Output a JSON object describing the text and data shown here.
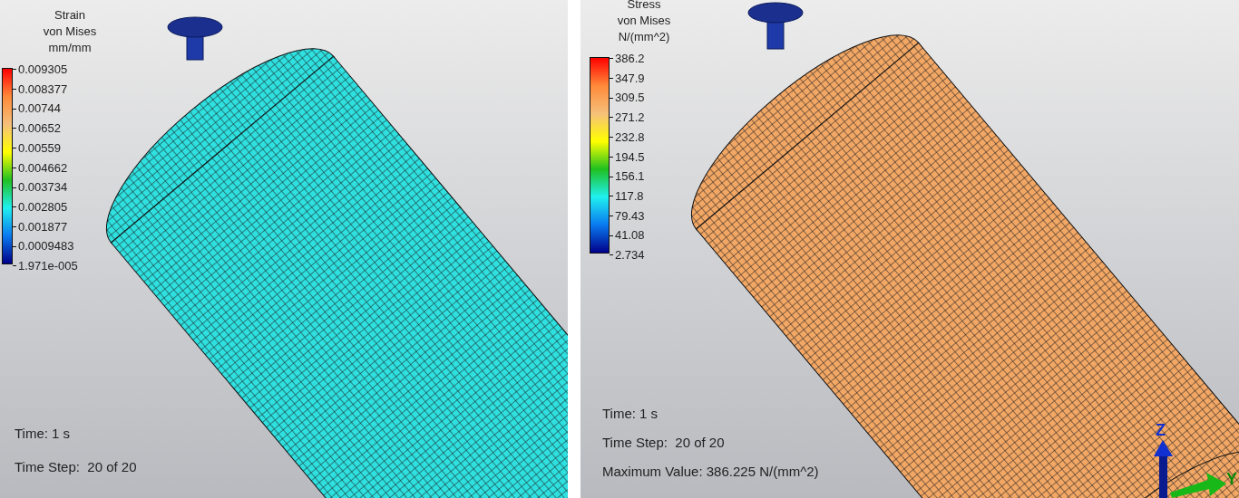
{
  "panels": [
    {
      "color": "#2fe0e0",
      "legend": {
        "title": [
          "Strain",
          "von Mises",
          "mm/mm"
        ],
        "labels": [
          "0.009305",
          "0.008377",
          "0.00744",
          "0.00652",
          "0.00559",
          "0.004662",
          "0.003734",
          "0.002805",
          "0.001877",
          "0.0009483",
          "1.971e-005"
        ]
      },
      "info": [
        "Time: 1 s",
        "Time Step:  20 of 20"
      ]
    },
    {
      "color": "#f2a765",
      "legend": {
        "title": [
          "Stress",
          "von Mises",
          "N/(mm^2)"
        ],
        "labels": [
          "386.2",
          "347.9",
          "309.5",
          "271.2",
          "232.8",
          "194.5",
          "156.1",
          "117.8",
          "79.43",
          "41.08",
          "2.734"
        ]
      },
      "info": [
        "Time: 1 s",
        "Time Step:  20 of 20",
        "Maximum Value: 386.225 N/(mm^2)"
      ],
      "triad": {
        "z": "Z",
        "y": "Y"
      }
    }
  ]
}
